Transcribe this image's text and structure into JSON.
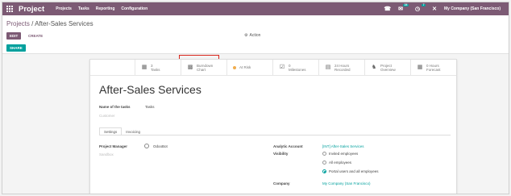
{
  "topbar": {
    "app_name": "Project",
    "menu": [
      "Projects",
      "Tasks",
      "Reporting",
      "Configuration"
    ],
    "messages_badge": "24",
    "activities_badge": "7",
    "company": "My Company (San Francisco)"
  },
  "control_panel": {
    "breadcrumb_root": "Projects",
    "breadcrumb_sep": "/",
    "breadcrumb_current": "After-Sales Services",
    "edit_label": "EDIT",
    "create_label": "CREATE",
    "action_label": "Action",
    "share_label": "SHARE"
  },
  "smart_buttons": [
    {
      "line1": "3",
      "line2": "Tasks",
      "icon": "tasks-icon"
    },
    {
      "line1": "Burndown",
      "line2": "Chart",
      "icon": "chart-icon"
    },
    {
      "line1": "At Risk",
      "line2": "",
      "icon": "status-dot"
    },
    {
      "line1": "0",
      "line2": "Milestones",
      "icon": "check-icon"
    },
    {
      "line1": "24 Hours",
      "line2": "Recorded",
      "icon": "calendar-icon"
    },
    {
      "line1": "Project",
      "line2": "Overview",
      "icon": "puzzle-icon"
    },
    {
      "line1": "0 Hours",
      "line2": "Forecast",
      "icon": "forecast-icon"
    }
  ],
  "form": {
    "title": "After-Sales Services",
    "tasks_label": "Name of the tasks",
    "tasks_value": "Tasks",
    "customer_placeholder": "Customer",
    "tabs": [
      "Settings",
      "Invoicing"
    ],
    "project_manager_label": "Project Manager",
    "project_manager_value": "OdooBot",
    "stage_placeholder": "Sandbox",
    "analytic_account_label": "Analytic Account",
    "analytic_account_value": "[INT] After-Sales Services",
    "visibility_label": "Visibility",
    "visibility_options": [
      "Invited employees",
      "All employees",
      "Portal users and all employees"
    ],
    "company_label": "Company",
    "company_value": "My Company (San Francisco)"
  }
}
